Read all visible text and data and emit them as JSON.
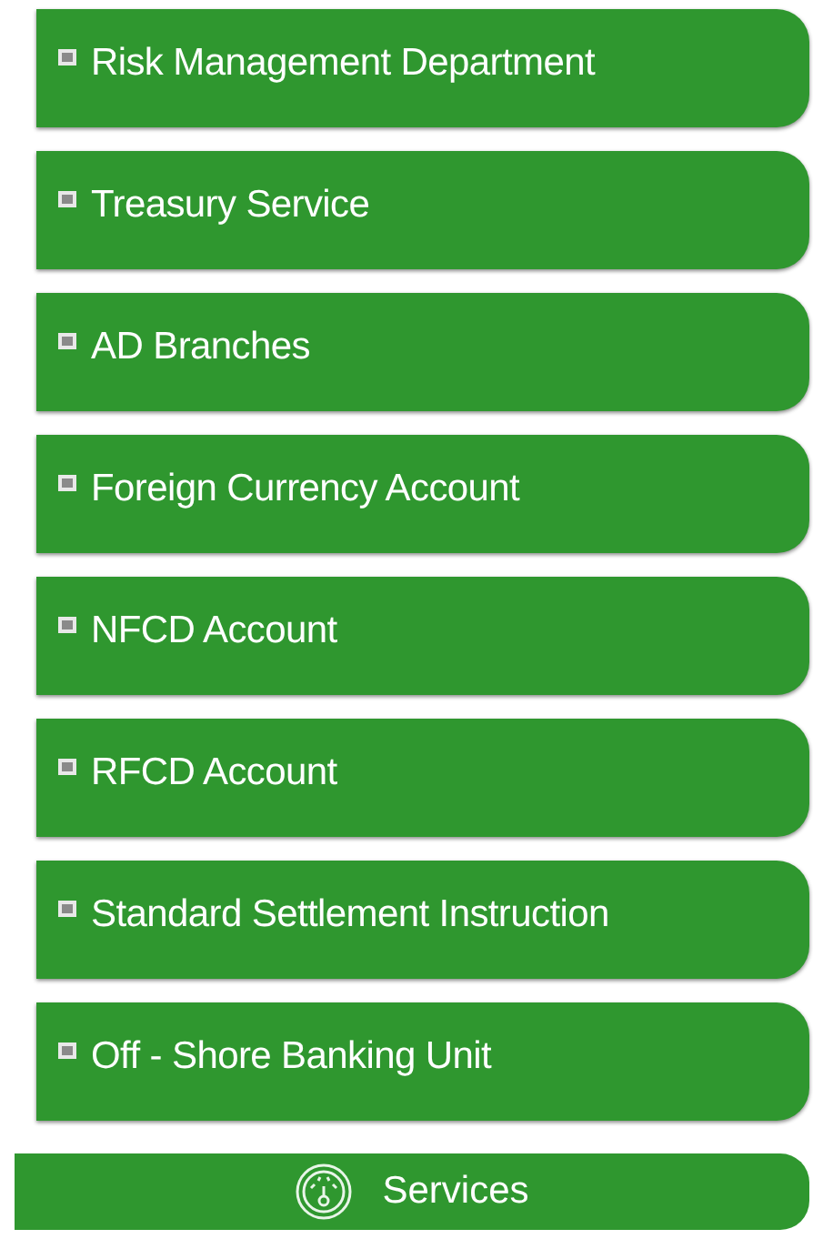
{
  "menu": [
    {
      "label": "Risk Management Department"
    },
    {
      "label": "Treasury Service"
    },
    {
      "label": "AD Branches"
    },
    {
      "label": "Foreign Currency Account"
    },
    {
      "label": "NFCD Account"
    },
    {
      "label": "RFCD Account"
    },
    {
      "label": "Standard Settlement Instruction"
    },
    {
      "label": "Off - Shore Banking Unit"
    }
  ],
  "footer": {
    "label": "Services"
  }
}
